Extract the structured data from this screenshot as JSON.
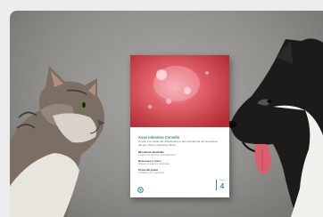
{
  "booklet": {
    "title": "Asse Intestino Cervello",
    "subtitle": "Il ruolo e le scelte del nutraceutico e del microbioma nel benessere del pet: focus e percorso clinico",
    "sections": [
      {
        "heading": "Microbiota intestinale",
        "text": "Il legame tra intestino e comportamento"
      },
      {
        "heading": "Benessere e stress",
        "text": "Strategie di supporto nutrizionale"
      },
      {
        "heading": "Protocolli pratici",
        "text": "Indicazioni per il veterinario"
      }
    ],
    "issue_label": "Volume",
    "issue_number": "4"
  },
  "colors": {
    "accent": "#3e8b90",
    "cover_red": "#d94650",
    "background": "#ececec"
  }
}
